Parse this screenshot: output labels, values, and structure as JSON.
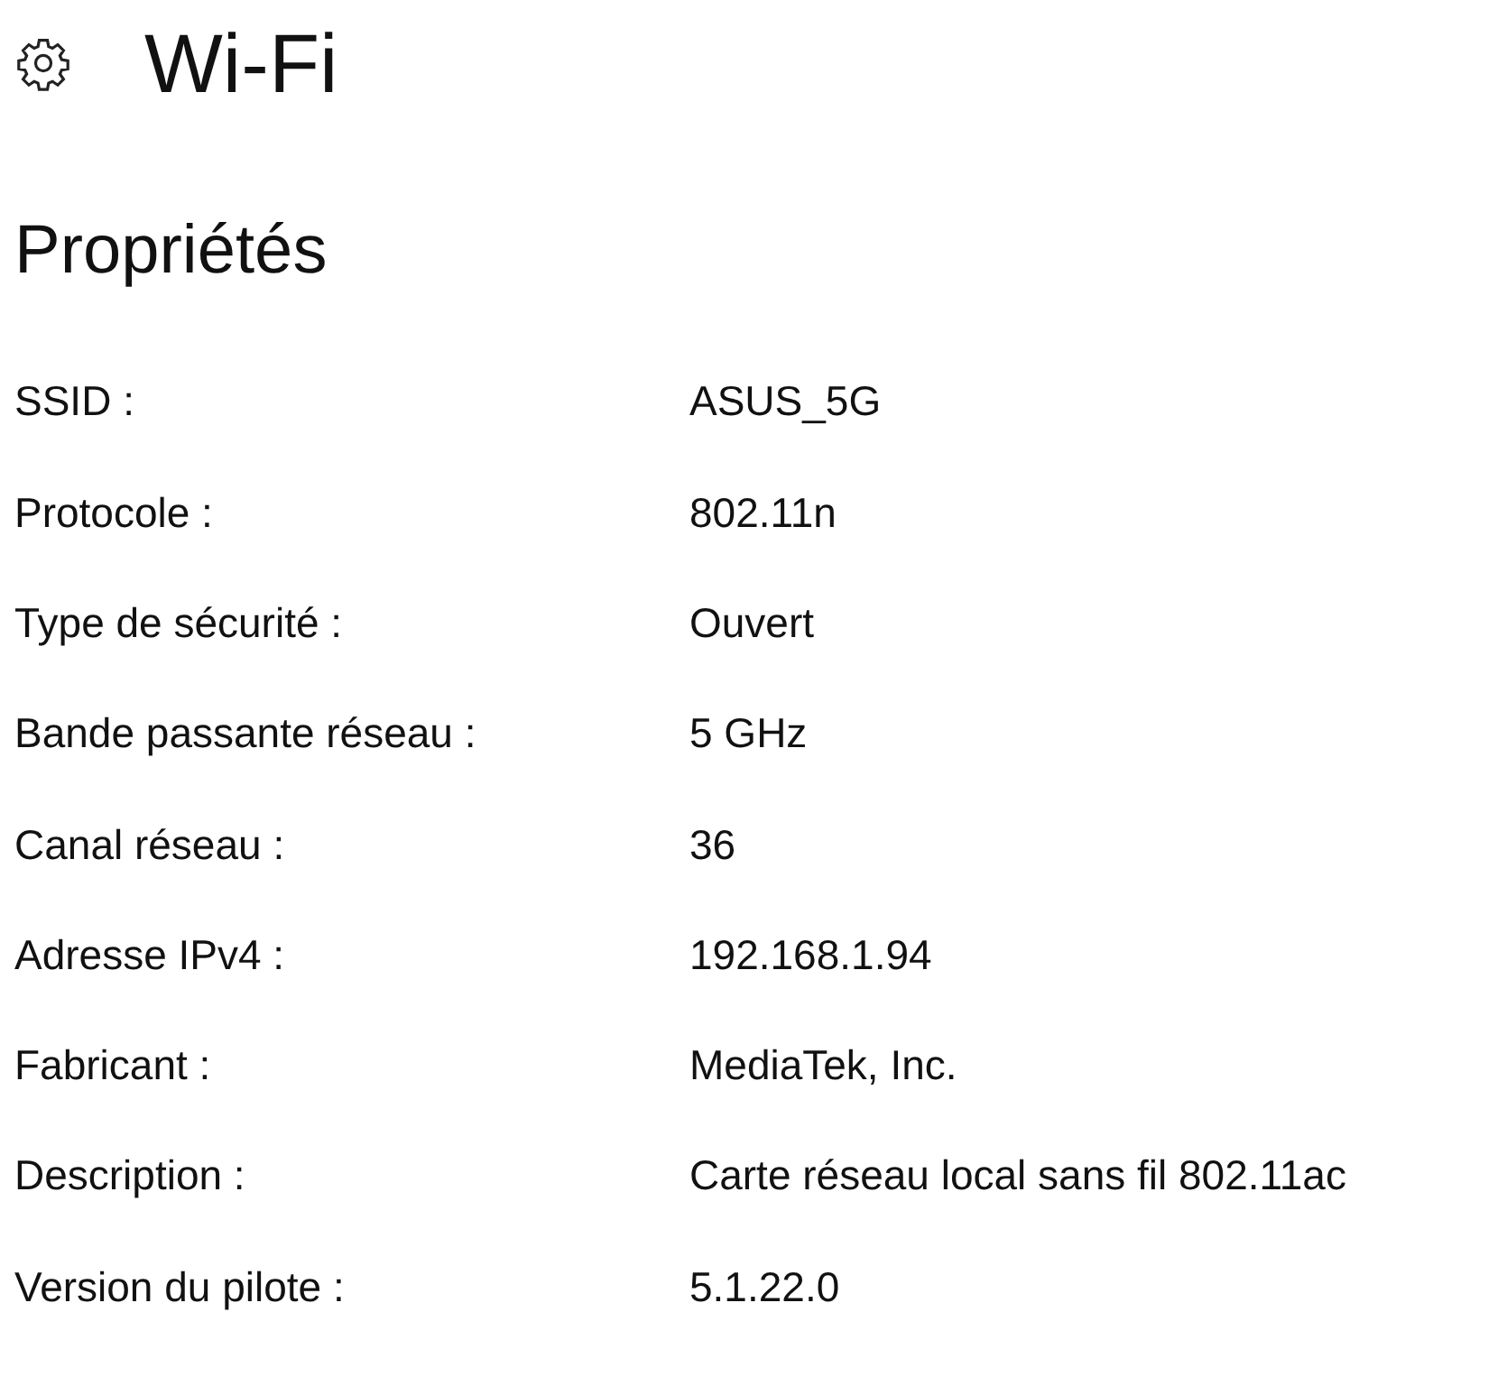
{
  "header": {
    "title": "Wi-Fi"
  },
  "section": {
    "title": "Propriétés"
  },
  "properties": [
    {
      "label": "SSID :",
      "value": "ASUS_5G"
    },
    {
      "label": "Protocole :",
      "value": "802.11n"
    },
    {
      "label": "Type de sécurité :",
      "value": "Ouvert"
    },
    {
      "label": "Bande passante réseau :",
      "value": "5 GHz"
    },
    {
      "label": "Canal réseau :",
      "value": "36"
    },
    {
      "label": "Adresse IPv4 :",
      "value": "192.168.1.94"
    },
    {
      "label": "Fabricant :",
      "value": "MediaTek, Inc."
    },
    {
      "label": "Description :",
      "value": "Carte réseau local sans fil 802.11ac"
    },
    {
      "label": "Version du pilote :",
      "value": "5.1.22.0"
    }
  ]
}
